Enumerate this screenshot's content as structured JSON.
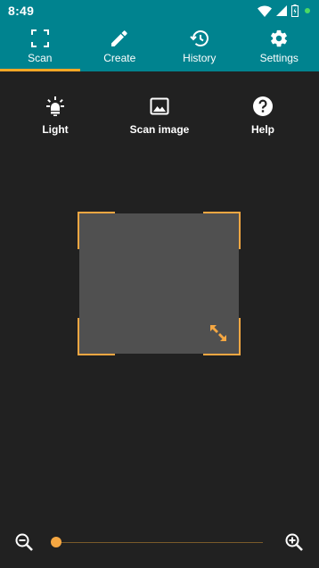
{
  "status_bar": {
    "time": "8:49",
    "icons": [
      "wifi-icon",
      "signal-icon",
      "battery-icon",
      "notification-dot"
    ]
  },
  "tabs": [
    {
      "label": "Scan",
      "icon": "scan-icon",
      "active": true
    },
    {
      "label": "Create",
      "icon": "pencil-icon",
      "active": false
    },
    {
      "label": "History",
      "icon": "history-icon",
      "active": false
    },
    {
      "label": "Settings",
      "icon": "gear-icon",
      "active": false
    }
  ],
  "actions": {
    "light": {
      "label": "Light",
      "icon": "flashlight-icon"
    },
    "scan_image": {
      "label": "Scan image",
      "icon": "image-icon"
    },
    "help": {
      "label": "Help",
      "icon": "help-icon"
    }
  },
  "zoom": {
    "value": 0,
    "min_icon": "zoom-out-icon",
    "max_icon": "zoom-in-icon"
  },
  "colors": {
    "primary": "#00838f",
    "accent": "#f5a742",
    "background": "#212121",
    "scan_area": "#505050"
  }
}
